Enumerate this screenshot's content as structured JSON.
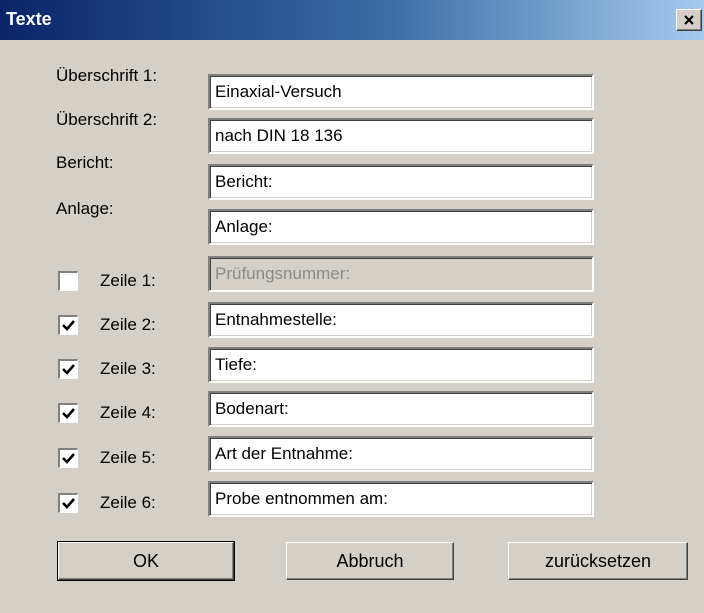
{
  "window": {
    "title": "Texte",
    "close_icon": "close-icon"
  },
  "fields": {
    "ueberschrift1": {
      "label": "Überschrift 1:",
      "value": "Einaxial-Versuch"
    },
    "ueberschrift2": {
      "label": "Überschrift 2:",
      "value": "nach DIN 18 136"
    },
    "bericht": {
      "label": "Bericht:",
      "value": "Bericht:"
    },
    "anlage": {
      "label": "Anlage:",
      "value": "Anlage:"
    }
  },
  "rows": [
    {
      "label": "Zeile 1:",
      "value": "Prüfungsnummer:",
      "checked": false,
      "enabled": false
    },
    {
      "label": "Zeile 2:",
      "value": "Entnahmestelle:",
      "checked": true,
      "enabled": true
    },
    {
      "label": "Zeile 3:",
      "value": "Tiefe:",
      "checked": true,
      "enabled": true
    },
    {
      "label": "Zeile 4:",
      "value": "Bodenart:",
      "checked": true,
      "enabled": true
    },
    {
      "label": "Zeile 5:",
      "value": "Art der Entnahme:",
      "checked": true,
      "enabled": true
    },
    {
      "label": "Zeile 6:",
      "value": "Probe entnommen am:",
      "checked": true,
      "enabled": true
    }
  ],
  "buttons": {
    "ok": "OK",
    "cancel": "Abbruch",
    "reset": "zurücksetzen"
  },
  "colors": {
    "titlebar_start": "#0a246a",
    "titlebar_end": "#a6caf0",
    "dialog_bg": "#d4d0c8",
    "disabled_text": "#8a8a8a"
  }
}
